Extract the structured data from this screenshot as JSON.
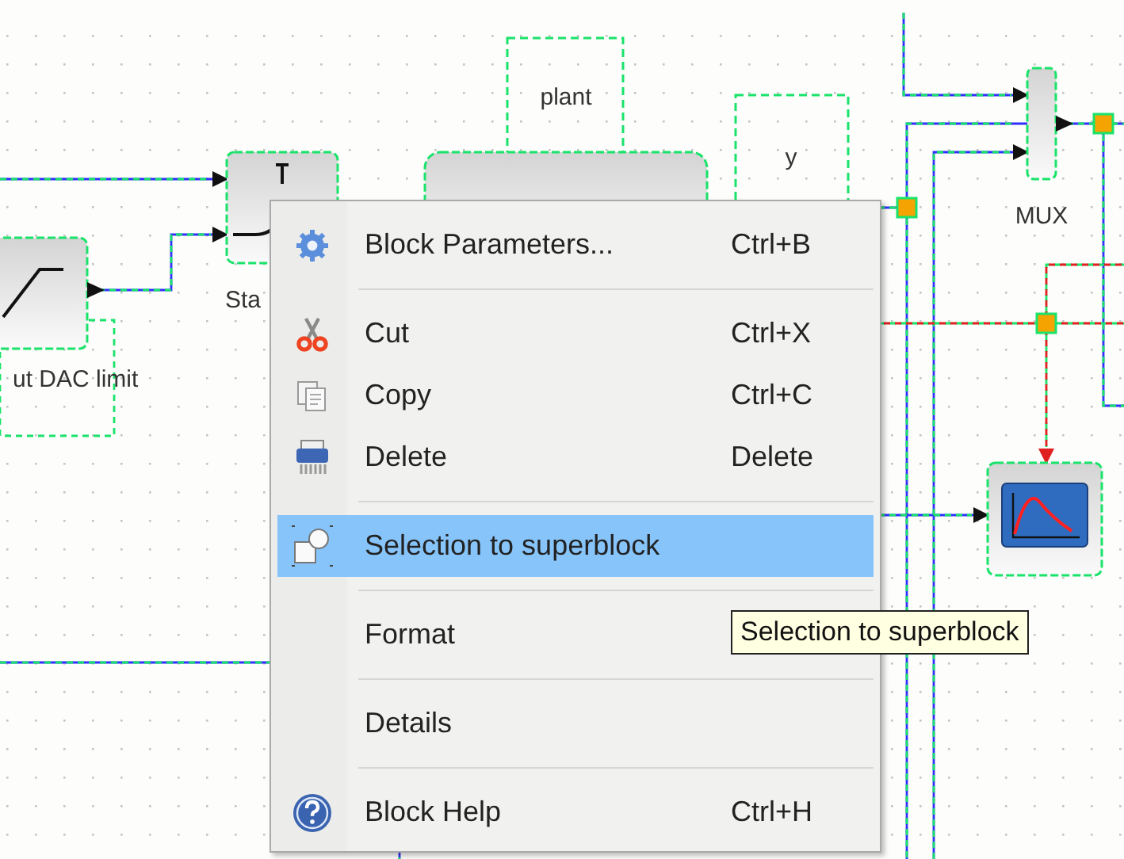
{
  "diagram": {
    "blocks": [
      {
        "kind": "annotation",
        "label": "plant"
      },
      {
        "kind": "annotation",
        "label": "y"
      },
      {
        "kind": "mux",
        "label": "MUX"
      },
      {
        "kind": "switch",
        "label": "Sta"
      },
      {
        "kind": "transfer"
      },
      {
        "kind": "saturation",
        "label": "ut DAC limit"
      },
      {
        "kind": "scope"
      }
    ]
  },
  "context_menu": {
    "items": [
      {
        "kind": "item",
        "label": "Block Parameters...",
        "shortcut": "Ctrl+B",
        "selected": false
      },
      {
        "kind": "separator"
      },
      {
        "kind": "item",
        "label": "Cut",
        "shortcut": "Ctrl+X",
        "selected": false
      },
      {
        "kind": "item",
        "label": "Copy",
        "shortcut": "Ctrl+C",
        "selected": false
      },
      {
        "kind": "item",
        "label": "Delete",
        "shortcut": "Delete",
        "selected": false
      },
      {
        "kind": "separator"
      },
      {
        "kind": "item",
        "label": "Selection to superblock",
        "selected": true
      },
      {
        "kind": "separator"
      },
      {
        "kind": "item",
        "label": "Format",
        "selected": false
      },
      {
        "kind": "separator"
      },
      {
        "kind": "item",
        "label": "Details",
        "selected": false
      },
      {
        "kind": "separator"
      },
      {
        "kind": "item",
        "label": "Block Help",
        "shortcut": "Ctrl+H",
        "selected": false
      }
    ]
  },
  "tooltip": {
    "text": "Selection to superblock"
  }
}
